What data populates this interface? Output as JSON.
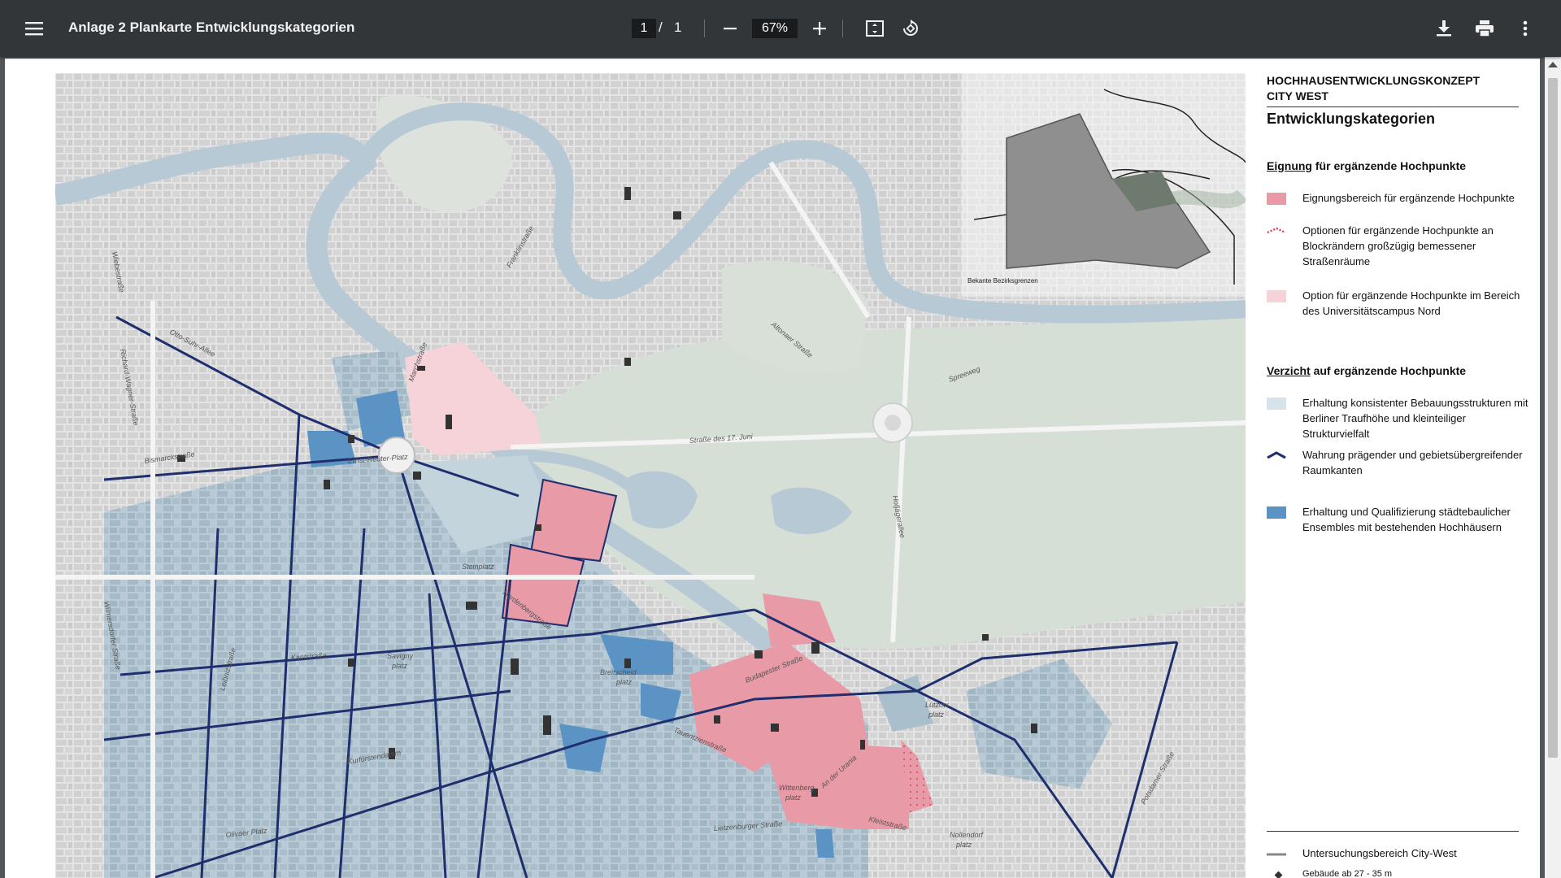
{
  "toolbar": {
    "title": "Anlage 2 Plankarte Entwicklungskategorien",
    "page_current": "1",
    "page_separator": "/",
    "page_total": "1",
    "zoom": "67%",
    "icons": {
      "menu": "hamburger-menu-icon",
      "zoom_out": "minus-icon",
      "zoom_in": "plus-icon",
      "fit": "fit-to-page-icon",
      "rotate": "rotate-icon",
      "download": "download-icon",
      "print": "print-icon",
      "more": "more-vert-icon"
    }
  },
  "map": {
    "inset_label": "Bekante Bezirksgrenzen",
    "streets": [
      "Otto-Suhr-Allee",
      "Richard-Wagner-Straße",
      "Bismarckstraße",
      "Ernst-Reuter-Platz",
      "Straße des 17. Juni",
      "Kantstraße",
      "Savigny platz",
      "Hardenbergstraße",
      "Kurfürstendamm",
      "Breitscheid platz",
      "Budapester Straße",
      "Lützow platz",
      "Tauentzienstraße",
      "Wittenberg platz",
      "An der Urania",
      "Kleiststraße",
      "Lietzenburger Straße",
      "Olivaer Platz",
      "Nollendorf platz",
      "Hofjägerallee",
      "Altonaer Straße",
      "Spreeweg",
      "Potsdamer Straße",
      "Wilmersdorfer Straße",
      "Leibnizstraße",
      "Steinplatz",
      "Franklinstraße",
      "Marchstraße",
      "Wiebestraße"
    ]
  },
  "legend": {
    "title_line1": "HOCHHAUSENTWICKLUNGSKONZEPT",
    "title_line2": "CITY WEST",
    "subtitle": "Entwicklungskategorien",
    "section1_keyword": "Eignung",
    "section1_rest": " für ergänzende Hochpunkte",
    "section2_keyword": "Verzicht",
    "section2_rest": " auf ergänzende Hochpunkte",
    "items": [
      {
        "text": "Eignungsbereich für ergänzende Hochpunkte",
        "color": "#e89aa6"
      },
      {
        "text": "Optionen für ergänzende Hochpunkte an Blockrändern großzügig bemessener Straßenräume",
        "color": "#d9465c"
      },
      {
        "text": "Option für ergänzende Hochpunkte im Bereich des Universitätscampus Nord",
        "color": "#f5d3d8"
      },
      {
        "text": "Erhaltung konsistenter Bebauungsstrukturen mit Berliner Traufhöhe und kleinteiliger Strukturvielfalt",
        "color": "#d6e3ea"
      },
      {
        "text": "Wahrung prägender und gebietsübergreifender Raumkanten",
        "color": "#1f2f6e"
      },
      {
        "text": "Erhaltung und Qualifizierung städtebaulicher Ensembles mit bestehenden Hochhäusern",
        "color": "#5b93c5"
      },
      {
        "text": "Untersuchungsbereich City-West",
        "color": "#888888"
      },
      {
        "text": "Gebäude ab 27 - 35 m",
        "color": "#333333"
      }
    ]
  },
  "colors": {
    "toolbar_bg": "#323639",
    "viewer_bg": "#525659",
    "water": "#b8c9d6",
    "park": "#d6dfd6",
    "built": "#dcdcdc",
    "blue_light": "#a9bfcc",
    "blue_dark": "#5b93c5",
    "pink": "#e89aa6",
    "pink_light": "#f5d3d8",
    "navy": "#1f2f6e"
  }
}
